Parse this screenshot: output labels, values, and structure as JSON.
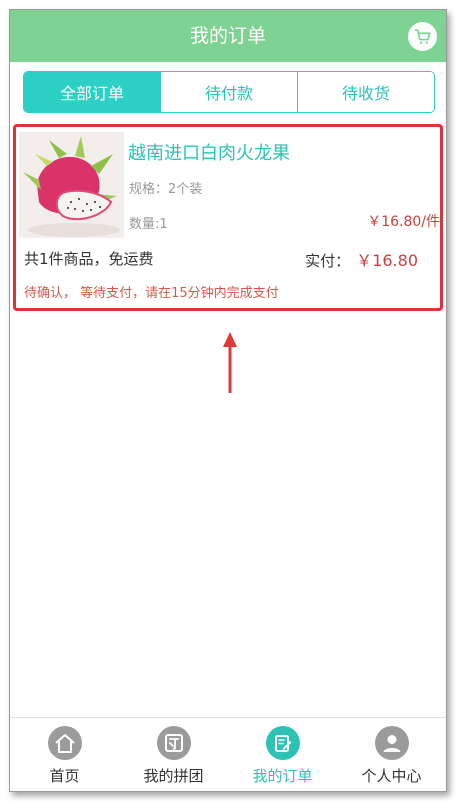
{
  "header": {
    "title": "我的订单",
    "cart_icon": "shopping-cart-icon"
  },
  "tabs": [
    {
      "label": "全部订单",
      "active": true
    },
    {
      "label": "待付款",
      "active": false
    },
    {
      "label": "待收货",
      "active": false
    }
  ],
  "order": {
    "product_name": "越南进口白肉火龙果",
    "spec": "规格：2个装",
    "quantity": "数量:1",
    "unit_price": "￥16.80/件",
    "summary": "共1件商品，免运费",
    "paid_label": "实付：",
    "paid_amount": "￥16.80",
    "status": "待确认， 等待支付，请在15分钟内完成支付"
  },
  "bottom_nav": [
    {
      "label": "首页",
      "icon": "home-icon",
      "active": false
    },
    {
      "label": "我的拼团",
      "icon": "group-icon",
      "active": false
    },
    {
      "label": "我的订单",
      "icon": "order-edit-icon",
      "active": true
    },
    {
      "label": "个人中心",
      "icon": "user-icon",
      "active": false
    }
  ],
  "colors": {
    "header": "#7ed392",
    "accent": "#2cd0c4",
    "highlight_border": "#d9343a",
    "price": "#c9423f"
  }
}
